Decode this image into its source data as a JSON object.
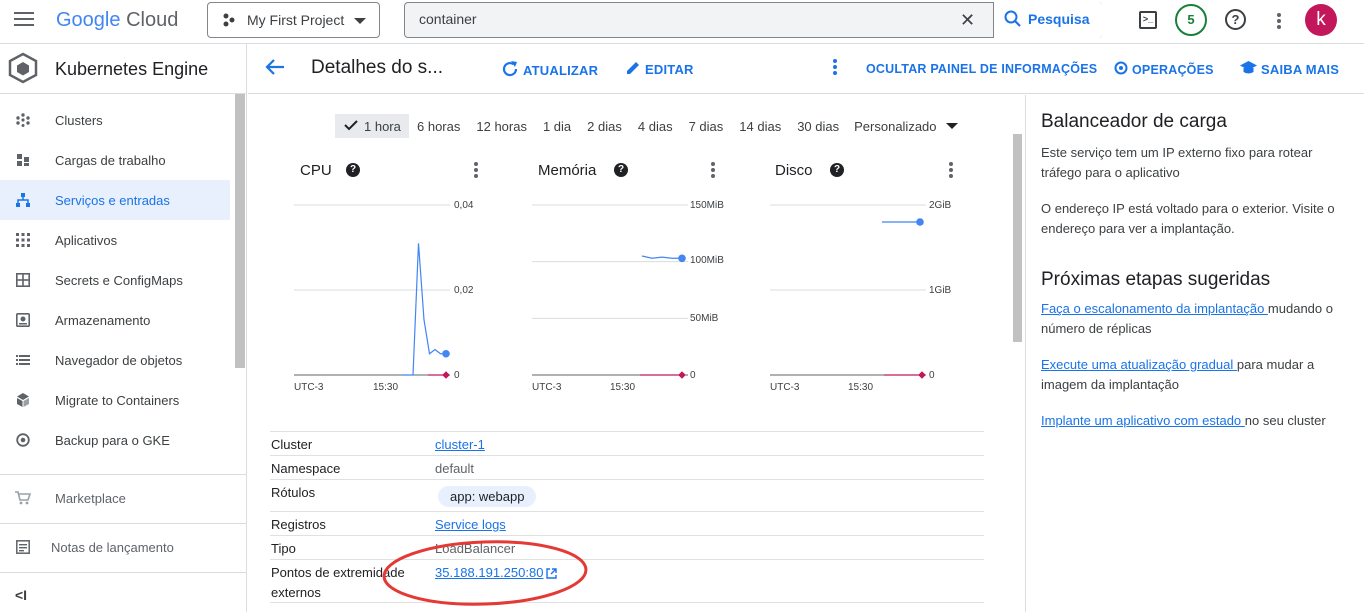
{
  "topbar": {
    "logo_google": "Google",
    "logo_cloud": "Cloud",
    "project": "My First Project",
    "search_value": "container",
    "search_button": "Pesquisa",
    "notifications_count": "5",
    "avatar_letter": "k"
  },
  "sidebar": {
    "product_title": "Kubernetes Engine",
    "items": [
      {
        "label": "Clusters"
      },
      {
        "label": "Cargas de trabalho"
      },
      {
        "label": "Serviços e entradas"
      },
      {
        "label": "Aplicativos"
      },
      {
        "label": "Secrets e ConfigMaps"
      },
      {
        "label": "Armazenamento"
      },
      {
        "label": "Navegador de objetos"
      },
      {
        "label": "Migrate to Containers"
      },
      {
        "label": "Backup para o GKE"
      }
    ],
    "marketplace": "Marketplace",
    "release_notes": "Notas de lançamento",
    "collapse": "<I"
  },
  "header": {
    "title": "Detalhes do s...",
    "refresh": "ATUALIZAR",
    "edit": "EDITAR",
    "hide_panel": "OCULTAR PAINEL DE INFORMAÇÕES",
    "operations": "OPERAÇÕES",
    "learn_more": "SAIBA MAIS"
  },
  "timerange": {
    "options": [
      "1 hora",
      "6 horas",
      "12 horas",
      "1 dia",
      "2 dias",
      "4 dias",
      "7 dias",
      "14 dias",
      "30 dias",
      "Personalizado"
    ],
    "selected": "1 hora"
  },
  "charts": [
    {
      "title": "CPU",
      "y_labels": [
        "0,04",
        "0,02",
        "0"
      ],
      "x_labels": [
        "UTC-3",
        "15:30"
      ]
    },
    {
      "title": "Memória",
      "y_labels": [
        "150MiB",
        "100MiB",
        "50MiB",
        "0"
      ],
      "x_labels": [
        "UTC-3",
        "15:30"
      ]
    },
    {
      "title": "Disco",
      "y_labels": [
        "2GiB",
        "1GiB",
        "0"
      ],
      "x_labels": [
        "UTC-3",
        "15:30"
      ]
    }
  ],
  "chart_data": [
    {
      "type": "line",
      "title": "CPU",
      "ylim": [
        0,
        0.04
      ],
      "series": [
        {
          "values": [
            0,
            0,
            0,
            0.031,
            0.013,
            0.005,
            0.006,
            0.005,
            0.005
          ]
        },
        {
          "values": [
            0,
            0
          ]
        }
      ]
    },
    {
      "type": "line",
      "title": "Memória",
      "ylim": [
        0,
        150
      ],
      "series": [
        {
          "values": [
            105,
            103,
            104,
            103,
            103
          ]
        },
        {
          "values": [
            0,
            0
          ]
        }
      ]
    },
    {
      "type": "line",
      "title": "Disco",
      "ylim": [
        0,
        2
      ],
      "series": [
        {
          "values": [
            1.8,
            1.8
          ]
        },
        {
          "values": [
            0,
            0,
            0
          ]
        }
      ]
    }
  ],
  "details": {
    "cluster_k": "Cluster",
    "cluster_v": "cluster-1",
    "namespace_k": "Namespace",
    "namespace_v": "default",
    "labels_k": "Rótulos",
    "labels_v": "app: webapp",
    "logs_k": "Registros",
    "logs_v": "Service logs",
    "type_k": "Tipo",
    "type_v": "LoadBalancer",
    "endpoints_k1": "Pontos de extremidade",
    "endpoints_k2": "externos",
    "endpoints_v": "35.188.191.250:80"
  },
  "right_panel": {
    "h1": "Balanceador de carga",
    "p1": "Este serviço tem um IP externo fixo para rotear tráfego para o aplicativo",
    "p2": "O endereço IP está voltado para o exterior. Visite o endereço para ver a implantação.",
    "h2": "Próximas etapas sugeridas",
    "s1_link": "Faça o escalonamento da implantação ",
    "s1_text": "mudando o número de réplicas",
    "s2_link": "Execute uma atualização gradual ",
    "s2_text": "para mudar a imagem da implantação",
    "s3_link": "Implante um aplicativo com estado ",
    "s3_text": "no seu cluster"
  },
  "colors": {
    "accent": "#1a73e8",
    "series_primary": "#4285f4",
    "series_secondary": "#c2185b",
    "annotation": "#e53935"
  }
}
